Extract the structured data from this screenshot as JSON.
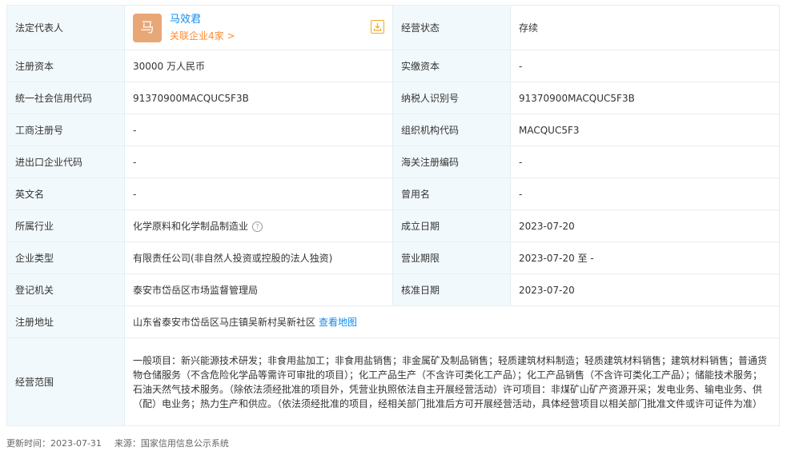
{
  "legal_rep": {
    "label": "法定代表人",
    "avatar_char": "马",
    "name": "马效君",
    "related": "关联企业4家 >",
    "status_label": "经营状态",
    "status_value": "存续"
  },
  "rows": [
    {
      "l1": "注册资本",
      "v1": "30000 万人民币",
      "l2": "实缴资本",
      "v2": "-"
    },
    {
      "l1": "统一社会信用代码",
      "v1": "91370900MACQUC5F3B",
      "l2": "纳税人识别号",
      "v2": "91370900MACQUC5F3B"
    },
    {
      "l1": "工商注册号",
      "v1": "-",
      "l2": "组织机构代码",
      "v2": "MACQUC5F3"
    },
    {
      "l1": "进出口企业代码",
      "v1": "-",
      "l2": "海关注册编码",
      "v2": "-"
    },
    {
      "l1": "英文名",
      "v1": "-",
      "l2": "曾用名",
      "v2": "-"
    },
    {
      "l1": "所属行业",
      "v1": "化学原料和化学制品制造业",
      "l2": "成立日期",
      "v2": "2023-07-20"
    },
    {
      "l1": "企业类型",
      "v1": "有限责任公司(非自然人投资或控股的法人独资)",
      "l2": "营业期限",
      "v2": "2023-07-20 至 -"
    },
    {
      "l1": "登记机关",
      "v1": "泰安市岱岳区市场监督管理局",
      "l2": "核准日期",
      "v2": "2023-07-20"
    }
  ],
  "address": {
    "label": "注册地址",
    "value": "山东省泰安市岱岳区马庄镇吴新村吴新社区",
    "map_link": "查看地图"
  },
  "scope": {
    "label": "经营范围",
    "value": "一般项目：新兴能源技术研发；非食用盐加工；非食用盐销售；非金属矿及制品销售；轻质建筑材料制造；轻质建筑材料销售；建筑材料销售；普通货物仓储服务（不含危险化学品等需许可审批的项目）；化工产品生产（不含许可类化工产品）；化工产品销售（不含许可类化工产品）；储能技术服务；石油天然气技术服务。（除依法须经批准的项目外，凭营业执照依法自主开展经营活动）许可项目：非煤矿山矿产资源开采；发电业务、输电业务、供（配）电业务；热力生产和供应。（依法须经批准的项目，经相关部门批准后方可开展经营活动，具体经营项目以相关部门批准文件或许可证件为准）"
  },
  "footer": {
    "update_time": "更新时间：2023-07-31",
    "source": "来源：国家信用信息公示系统"
  },
  "colors": {
    "accent": "#128bed",
    "orange": "#fd8b32",
    "label_bg": "#f2f9fc",
    "border": "#e4eef6"
  }
}
